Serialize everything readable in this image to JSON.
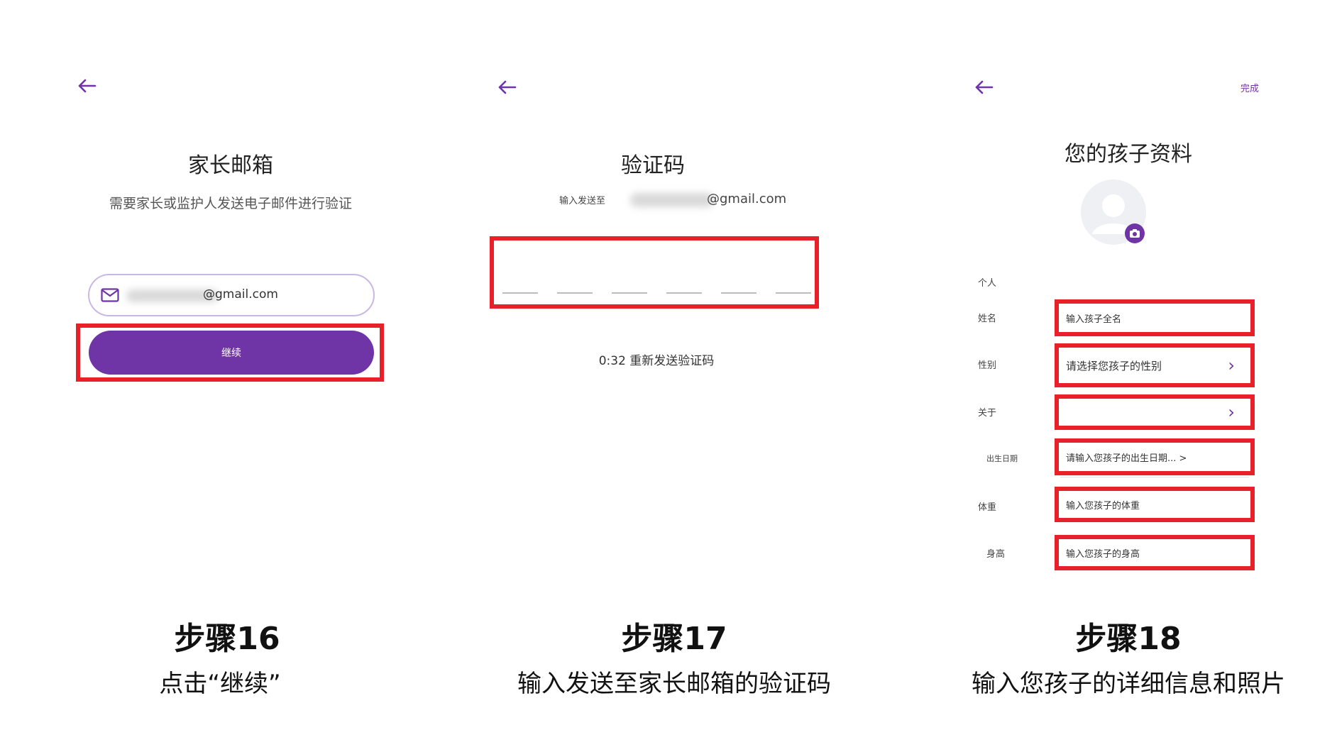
{
  "step16": {
    "header_title": "家长邮箱",
    "subtitle": "需要家长或监护人发送电子邮件进行验证",
    "email_suffix": "@gmail.com",
    "continue_label": "继续",
    "step_title": "步骤16",
    "step_desc": "点击“继续”"
  },
  "step17": {
    "header_title": "验证码",
    "sent_to_label": "输入发送至",
    "email_suffix": "@gmail.com",
    "code_slots": 6,
    "resend_text": "0:32 重新发送验证码",
    "step_title": "步骤17",
    "step_desc": "输入发送至家长邮箱的验证码"
  },
  "step18": {
    "done_label": "完成",
    "header_title": "您的孩子资料",
    "section_label": "个人",
    "fields": [
      {
        "label": "姓名",
        "value": "输入孩子全名"
      },
      {
        "label": "性别",
        "value": "请选择您孩子的性别"
      },
      {
        "label": "关于",
        "value": ""
      },
      {
        "label": "出生日期",
        "value": "请输入您孩子的出生日期... >"
      },
      {
        "label": "体重",
        "value": "输入您孩子的体重"
      },
      {
        "label": "身高",
        "value": "输入您孩子的身高"
      }
    ],
    "step_title": "步骤18",
    "step_desc": "输入您孩子的详细信息和照片"
  },
  "colors": {
    "accent": "#6f34a6",
    "highlight": "#e8202a",
    "input_border": "#c9b7e6"
  },
  "icons": {
    "back": "arrow-left-icon",
    "mail": "envelope-icon",
    "avatar": "user-avatar-icon",
    "camera": "camera-icon",
    "chevron": "chevron-right-icon"
  }
}
